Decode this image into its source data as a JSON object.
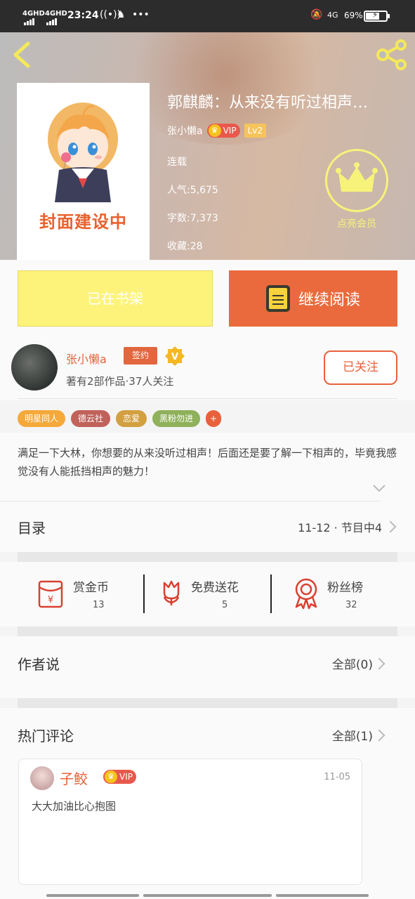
{
  "status_bar": {
    "sim1": "4GHD",
    "sim2": "4GHD",
    "time": "23:24",
    "network": "4G",
    "battery_pct": "69%",
    "battery_level": 0.69
  },
  "header": {
    "cover_text": "封面建设中",
    "title": "郭麒麟：从来没有听过相声…",
    "author": "张小懒a",
    "vip_label": "VIP",
    "level": "Lv2",
    "status": "连载",
    "popularity": "人气:5,675",
    "word_count": "字数:7,373",
    "favorites": "收藏:28",
    "member_label": "点亮会员",
    "colors": {
      "member": "#f7f27a"
    }
  },
  "actions": {
    "shelf_label": "已在书架",
    "read_label": "继续阅读"
  },
  "author_card": {
    "name": "张小懒a",
    "sign_label": "签约",
    "desc": "著有2部作品·37人关注",
    "follow_label": "已关注",
    "accent": "#e8613c"
  },
  "tags": [
    {
      "label": "明星同人",
      "color": "#f5a93a"
    },
    {
      "label": "德云社",
      "color": "#c0615a"
    },
    {
      "label": "恋爱",
      "color": "#d3a041"
    },
    {
      "label": "黑粉勿进",
      "color": "#8fb15b"
    },
    {
      "label": "+",
      "color": "#e8613c"
    }
  ],
  "intro": {
    "text": "满足一下大林，你想要的从来没听过相声！后面还是要了解一下相声的，毕竟我感觉没有人能抵挡相声的魅力！"
  },
  "toc": {
    "label": "目录",
    "status": "11-12 · 节目中4"
  },
  "stats": [
    {
      "label": "赏金币",
      "value": "13",
      "icon": "red-envelope-icon"
    },
    {
      "label": "免费送花",
      "value": "5",
      "icon": "flower-icon"
    },
    {
      "label": "粉丝榜",
      "value": "32",
      "icon": "medal-icon"
    }
  ],
  "author_says": {
    "label": "作者说",
    "more": "全部(0)"
  },
  "hot_comments": {
    "label": "热门评论",
    "more": "全部(1)",
    "items": [
      {
        "name": "子鲛",
        "vip": "VIP",
        "date": "11-05",
        "text": "大大加油比心抱图"
      }
    ]
  }
}
